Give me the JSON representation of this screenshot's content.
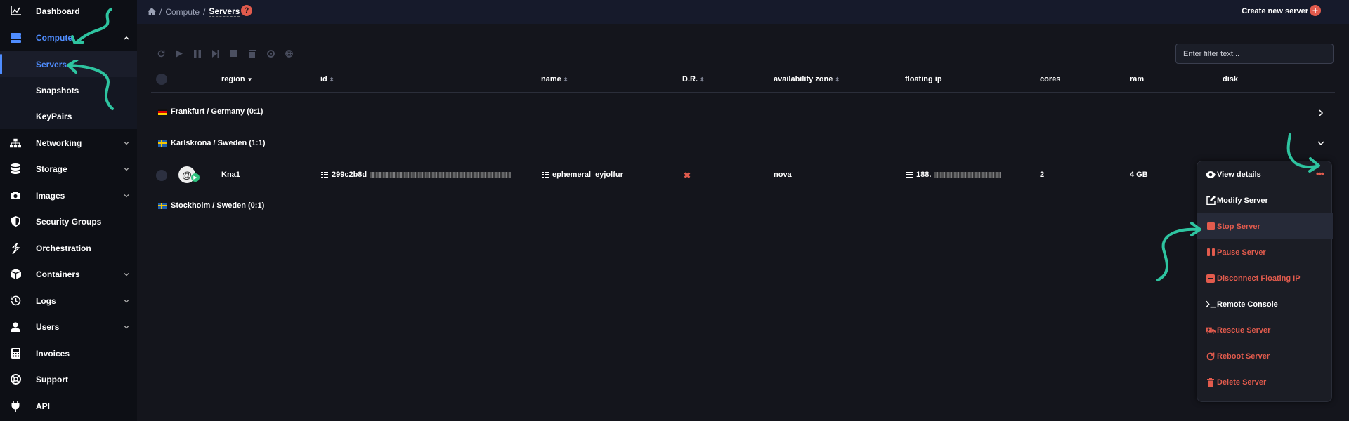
{
  "sidebar": {
    "items": [
      {
        "label": "Dashboard",
        "icon": "chart-icon"
      },
      {
        "label": "Compute",
        "icon": "server-icon"
      },
      {
        "label": "Servers"
      },
      {
        "label": "Snapshots"
      },
      {
        "label": "KeyPairs"
      },
      {
        "label": "Networking",
        "icon": "network-icon"
      },
      {
        "label": "Storage",
        "icon": "database-icon"
      },
      {
        "label": "Images",
        "icon": "camera-icon"
      },
      {
        "label": "Security Groups",
        "icon": "shield-icon"
      },
      {
        "label": "Orchestration",
        "icon": "orchestration-icon"
      },
      {
        "label": "Containers",
        "icon": "box-icon"
      },
      {
        "label": "Logs",
        "icon": "history-icon"
      },
      {
        "label": "Users",
        "icon": "user-icon"
      },
      {
        "label": "Invoices",
        "icon": "calculator-icon"
      },
      {
        "label": "Support",
        "icon": "lifebuoy-icon"
      },
      {
        "label": "API",
        "icon": "plug-icon"
      }
    ]
  },
  "breadcrumb": {
    "part1": "Compute",
    "sep": "/",
    "current": "Servers",
    "help": "?"
  },
  "header": {
    "create_label": "Create new server",
    "create_icon": "+"
  },
  "filter": {
    "placeholder": "Enter filter text..."
  },
  "table": {
    "columns": [
      "region",
      "id",
      "name",
      "D.R.",
      "availability zone",
      "floating ip",
      "cores",
      "ram",
      "disk"
    ],
    "groups": [
      {
        "label": "Frankfurt / Germany (0:1)"
      },
      {
        "label": "Karlskrona / Sweden (1:1)"
      },
      {
        "label": "Stockholm / Sweden (0:1)"
      }
    ],
    "row": {
      "region": "Kna1",
      "id": "299c2b8d",
      "name": "ephemeral_eyjolfur",
      "dr": "✖",
      "zone": "nova",
      "floating_ip": "188.",
      "cores": "2",
      "ram": "4 GB",
      "actions": "•••"
    }
  },
  "menu": {
    "items": [
      {
        "label": "View details",
        "icon": "eye-icon"
      },
      {
        "label": "Modify Server",
        "icon": "edit-icon"
      },
      {
        "label": "Stop Server",
        "icon": "stop-icon"
      },
      {
        "label": "Pause Server",
        "icon": "pause-icon"
      },
      {
        "label": "Disconnect Floating IP",
        "icon": "minus-square-icon"
      },
      {
        "label": "Remote Console",
        "icon": "terminal-icon"
      },
      {
        "label": "Rescue Server",
        "icon": "truck-icon"
      },
      {
        "label": "Reboot Server",
        "icon": "reboot-icon"
      },
      {
        "label": "Delete Server",
        "icon": "trash-icon"
      }
    ]
  },
  "colors": {
    "accent": "#4f8dff",
    "danger": "#e25b4d",
    "arrow": "#2ec4a0",
    "status": "#2ec27e"
  }
}
